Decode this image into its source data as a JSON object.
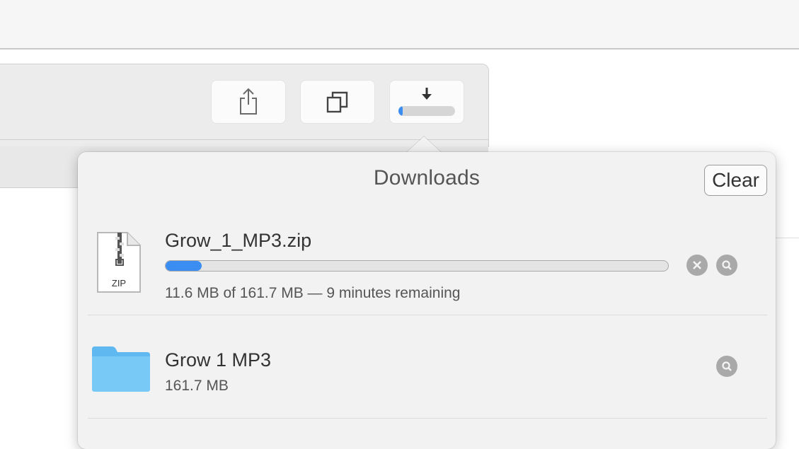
{
  "toolbar": {
    "buttons": [
      {
        "name": "share-icon"
      },
      {
        "name": "tabs-overview-icon"
      },
      {
        "name": "downloads-icon",
        "progress": 0.07
      }
    ]
  },
  "downloads": {
    "title": "Downloads",
    "clear_label": "Clear",
    "items": [
      {
        "icon": "zip-file-icon",
        "icon_label": "ZIP",
        "name": "Grow_1_MP3.zip",
        "progress": 0.072,
        "detail": "11.6 MB of 161.7 MB — 9 minutes remaining",
        "actions": [
          "stop-icon",
          "reveal-magnifier-icon"
        ]
      },
      {
        "icon": "folder-icon",
        "name": "Grow 1 MP3",
        "detail": "161.7 MB",
        "actions": [
          "reveal-magnifier-icon"
        ]
      }
    ]
  },
  "colors": {
    "accent": "#3c8df2",
    "folder": "#6cc3f5",
    "popover_bg": "#f2f2f2"
  }
}
